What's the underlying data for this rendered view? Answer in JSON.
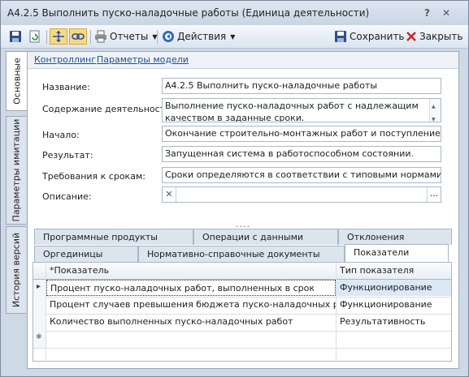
{
  "window": {
    "title": "А4.2.5 Выполнить пуско-наладочные работы (Единица деятельности)",
    "help": "?",
    "close": "✕"
  },
  "toolbar": {
    "reports_label": "Отчеты",
    "actions_label": "Действия",
    "save_label": "Сохранить",
    "close_label": "Закрыть"
  },
  "side_tabs": [
    {
      "label": "Основные"
    },
    {
      "label": "Параметры имитации"
    },
    {
      "label": "История версий"
    }
  ],
  "links": {
    "controlling": "Контроллинг",
    "model_params": "Параметры модели"
  },
  "form": {
    "name_label": "Название:",
    "name_value": "А4.2.5 Выполнить пуско-наладочные работы",
    "content_label": "Содержание деятельности:",
    "content_value": "Выполнение пуско-наладочных работ с надлежащим качеством в заданные сроки.",
    "start_label": "Начало:",
    "start_value": "Окончание строительно-монтажных работ и поступление исполни",
    "result_label": "Результат:",
    "result_value": "Запущенная система в работоспособном состоянии.",
    "deadline_label": "Требования к срокам:",
    "deadline_value": "Сроки определяются в соответствии с типовыми нормами.",
    "description_label": "Описание:",
    "description_value": "",
    "ellipsis": "..."
  },
  "splitter": "....",
  "tabs": {
    "row1": [
      "Программные продукты",
      "Операции с данными",
      "Отклонения"
    ],
    "row2": [
      "Оргединицы",
      "Нормативно-справочные документы",
      "Показатели"
    ]
  },
  "grid": {
    "headers": [
      "*Показатель",
      "Тип показателя"
    ],
    "rows": [
      {
        "name": "Процент пуско-наладочных работ, выполненных в срок",
        "type": "Функционирование"
      },
      {
        "name": "Процент случаев превышения бюджета пуско-наладочных работ",
        "type": "Функционирование"
      },
      {
        "name": "Количество выполненных пуско-наладочных работ",
        "type": "Результативность"
      }
    ],
    "new_row_marker": "✱",
    "current_row_marker": "▸"
  },
  "colors": {
    "accent": "#1f4e9c",
    "selected_row": "#dde8f6",
    "window_bg": "#cfd9e6"
  }
}
